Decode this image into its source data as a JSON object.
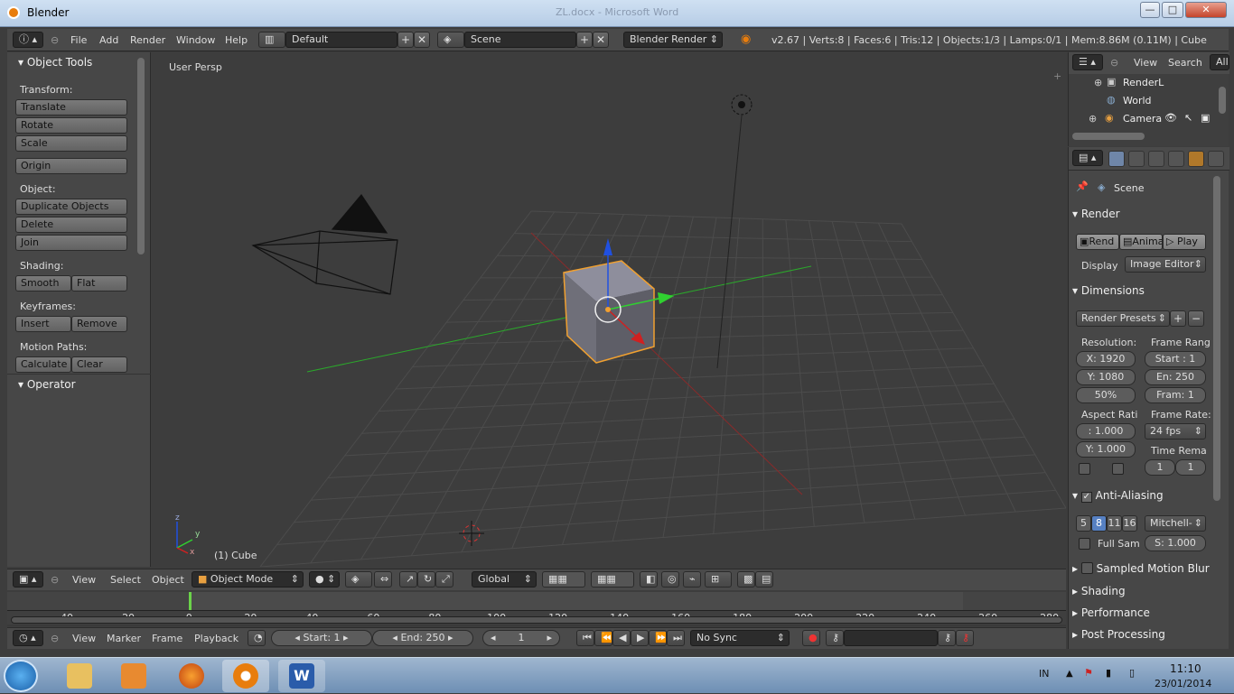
{
  "window": {
    "app_name": "Blender",
    "doc_title": "ZL.docx - Microsoft Word",
    "min": "—",
    "max": "□",
    "close": "✕"
  },
  "info_header": {
    "menus": [
      "File",
      "Add",
      "Render",
      "Window",
      "Help"
    ],
    "layout": "Default",
    "scene": "Scene",
    "engine": "Blender Render",
    "stats": "v2.67 | Verts:8 | Faces:6 | Tris:12 | Objects:1/3 | Lamps:0/1 | Mem:8.86M (0.11M) | Cube"
  },
  "object_tools": {
    "title": "Object Tools",
    "transform_label": "Transform:",
    "translate": "Translate",
    "rotate": "Rotate",
    "scale": "Scale",
    "origin": "Origin",
    "object_label": "Object:",
    "duplicate": "Duplicate Objects",
    "delete": "Delete",
    "join": "Join",
    "shading_label": "Shading:",
    "smooth": "Smooth",
    "flat": "Flat",
    "keyframes_label": "Keyframes:",
    "insert": "Insert",
    "remove": "Remove",
    "motion_paths_label": "Motion Paths:",
    "calculate": "Calculate",
    "clear": "Clear",
    "operator": "Operator"
  },
  "viewport": {
    "view_name": "User Persp",
    "active_object": "(1) Cube",
    "axis_x": "x",
    "axis_y": "y",
    "axis_z": "z"
  },
  "view3d_header": {
    "menus": [
      "View",
      "Select",
      "Object"
    ],
    "mode": "Object Mode",
    "orientation": "Global"
  },
  "timeline": {
    "ticks": [
      "-40",
      "-20",
      "0",
      "20",
      "40",
      "60",
      "80",
      "100",
      "120",
      "140",
      "160",
      "180",
      "200",
      "220",
      "240",
      "260",
      "280"
    ],
    "current_frame_position_frame": 0
  },
  "timeline_header": {
    "menus": [
      "View",
      "Marker",
      "Frame",
      "Playback"
    ],
    "start": "Start: 1",
    "end": "End: 250",
    "current": "1",
    "sync": "No Sync"
  },
  "outliner": {
    "view": "View",
    "search": "Search",
    "all": "All",
    "items": [
      "RenderL",
      "World",
      "Camera"
    ]
  },
  "properties": {
    "context": "Scene",
    "render_section": "Render",
    "render_btn": "Rend",
    "anim_btn": "Anima",
    "play_btn": "Play",
    "display_label": "Display",
    "display_value": "Image Editor",
    "dimensions_section": "Dimensions",
    "presets": "Render Presets",
    "resolution_label": "Resolution:",
    "res_x": "X: 1920",
    "res_y": "Y: 1080",
    "res_pct": "50%",
    "frame_range_label": "Frame Rang",
    "fr_start": "Start : 1",
    "fr_end": "En: 250",
    "fr_step": "Fram: 1",
    "aspect_label": "Aspect Rati",
    "aspect_x": ": 1.000",
    "aspect_y": "Y: 1.000",
    "frame_rate_label": "Frame Rate:",
    "fps": "24 fps",
    "time_remap_label": "Time Rema",
    "remap_old": "1",
    "remap_new": "1",
    "aa_section": "Anti-Aliasing",
    "aa_samples": [
      "5",
      "8",
      "11",
      "16"
    ],
    "aa_selected": "8",
    "aa_filter": "Mitchell-",
    "full_sample": "Full Sam",
    "filter_size": "S: 1.000",
    "collapsed_sections": [
      "Sampled Motion Blur",
      "Shading",
      "Performance",
      "Post Processing"
    ]
  },
  "taskbar": {
    "lang": "IN",
    "time": "11:10",
    "date": "23/01/2014"
  },
  "colors": {
    "selection": "#f0a030",
    "x_axis": "#d02020",
    "y_axis": "#30d030",
    "z_axis": "#2050e0",
    "accent": "#6f86a8"
  }
}
